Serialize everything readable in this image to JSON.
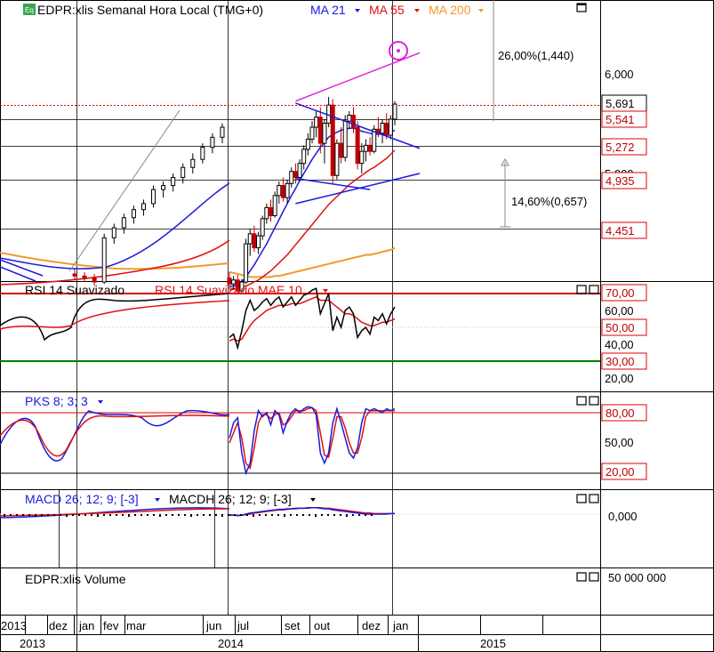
{
  "colors": {
    "grid": "#000000",
    "price_up": "#000000",
    "price_down": "#c00000",
    "ma21": "#1a1adc",
    "ma55": "#e01010",
    "ma200": "#f29a2e",
    "rsi": "#000000",
    "rsi_ma": "#e01010",
    "level_red": "#e00000",
    "level_green": "#008000",
    "trend_blue": "#1a1adc",
    "trend_magenta": "#e020e0"
  },
  "price_panel": {
    "badge": "Eq",
    "title": "EDPR:xlis Semanal Hora Local (TMG+0)",
    "indicators": [
      {
        "label": "MA 21",
        "color": "#1a1adc"
      },
      {
        "label": "MA 55",
        "color": "#e01010"
      },
      {
        "label": "MA 200",
        "color": "#f29a2e"
      }
    ],
    "axis_labels": [
      "6,000",
      "5,000"
    ],
    "price_tags": [
      {
        "text": "5,691",
        "kind": "last"
      },
      {
        "text": "5,541",
        "kind": "red"
      },
      {
        "text": "5,272",
        "kind": "red"
      },
      {
        "text": "4,935",
        "kind": "red"
      },
      {
        "text": "4,451",
        "kind": "red"
      }
    ],
    "annotations": [
      "26,00%(1,440)",
      "14,60%(0,657)"
    ]
  },
  "rsi_panel": {
    "title": "RSI 14 Suavizado",
    "title2": "RSI 14 Suavizado MAE 10",
    "axis_labels": [
      "60,00",
      "40,00",
      "20,00"
    ],
    "level_tags": [
      {
        "text": "70,00",
        "kind": "red"
      },
      {
        "text": "50,00",
        "kind": "red"
      },
      {
        "text": "30,00",
        "kind": "red"
      }
    ]
  },
  "pks_panel": {
    "title": "PKS 8; 3; 3",
    "axis_labels": [
      "50,00"
    ],
    "level_tags": [
      {
        "text": "80,00",
        "kind": "red"
      },
      {
        "text": "20,00",
        "kind": "red"
      }
    ]
  },
  "macd_panel": {
    "title": "MACD 26; 12; 9; [-3]",
    "title2": "MACDH 26; 12; 9; [-3]",
    "axis_labels": [
      "0,000"
    ]
  },
  "volume_panel": {
    "title": "EDPR:xlis Volume",
    "axis_labels": [
      "50 000 000"
    ]
  },
  "time_axis": {
    "months": [
      "2013",
      "dez",
      "jan",
      "fev",
      "mar",
      "jun",
      "jul",
      "set",
      "out",
      "dez",
      "jan"
    ],
    "years": [
      "2013",
      "2014",
      "2015"
    ]
  },
  "chart_data": {
    "type": "candlestick",
    "title": "EDPR:xlis Semanal Hora Local (TMG+0)",
    "period": "weekly",
    "ylim": [
      3.8,
      6.6
    ],
    "candles": [
      {
        "o": 3.96,
        "h": 4.02,
        "l": 3.86,
        "c": 3.9
      },
      {
        "o": 3.9,
        "h": 3.98,
        "l": 3.84,
        "c": 3.94
      },
      {
        "o": 3.94,
        "h": 3.99,
        "l": 3.8,
        "c": 3.83
      },
      {
        "o": 3.83,
        "h": 3.95,
        "l": 3.8,
        "c": 3.92
      },
      {
        "o": 3.92,
        "h": 4.35,
        "l": 3.9,
        "c": 4.3
      },
      {
        "o": 4.3,
        "h": 4.45,
        "l": 4.18,
        "c": 4.4
      },
      {
        "o": 4.4,
        "h": 4.48,
        "l": 4.22,
        "c": 4.26
      },
      {
        "o": 4.26,
        "h": 4.42,
        "l": 4.2,
        "c": 4.38
      },
      {
        "o": 4.38,
        "h": 4.58,
        "l": 4.34,
        "c": 4.55
      },
      {
        "o": 4.55,
        "h": 4.7,
        "l": 4.5,
        "c": 4.66
      },
      {
        "o": 4.66,
        "h": 4.74,
        "l": 4.52,
        "c": 4.58
      },
      {
        "o": 4.58,
        "h": 4.82,
        "l": 4.56,
        "c": 4.78
      },
      {
        "o": 4.78,
        "h": 4.92,
        "l": 4.7,
        "c": 4.88
      },
      {
        "o": 4.88,
        "h": 4.96,
        "l": 4.72,
        "c": 4.76
      },
      {
        "o": 4.76,
        "h": 4.94,
        "l": 4.7,
        "c": 4.9
      },
      {
        "o": 4.9,
        "h": 5.06,
        "l": 4.86,
        "c": 5.02
      },
      {
        "o": 5.02,
        "h": 5.1,
        "l": 4.9,
        "c": 4.96
      },
      {
        "o": 4.96,
        "h": 5.14,
        "l": 4.92,
        "c": 5.1
      },
      {
        "o": 5.1,
        "h": 5.28,
        "l": 5.04,
        "c": 5.24
      },
      {
        "o": 5.24,
        "h": 5.4,
        "l": 5.18,
        "c": 5.34
      },
      {
        "o": 5.34,
        "h": 5.52,
        "l": 5.3,
        "c": 5.46
      },
      {
        "o": 5.46,
        "h": 5.62,
        "l": 5.36,
        "c": 5.56
      },
      {
        "o": 5.56,
        "h": 5.66,
        "l": 5.2,
        "c": 5.3
      },
      {
        "o": 5.3,
        "h": 5.54,
        "l": 5.1,
        "c": 5.5
      },
      {
        "o": 5.5,
        "h": 5.76,
        "l": 5.46,
        "c": 5.68
      },
      {
        "o": 5.68,
        "h": 5.74,
        "l": 4.9,
        "c": 4.98
      },
      {
        "o": 4.98,
        "h": 5.34,
        "l": 4.94,
        "c": 5.3
      },
      {
        "o": 5.3,
        "h": 5.46,
        "l": 5.1,
        "c": 5.16
      },
      {
        "o": 5.16,
        "h": 5.58,
        "l": 5.12,
        "c": 5.52
      },
      {
        "o": 5.52,
        "h": 5.62,
        "l": 5.44,
        "c": 5.58
      },
      {
        "o": 5.58,
        "h": 5.66,
        "l": 5.4,
        "c": 5.46
      },
      {
        "o": 5.46,
        "h": 5.52,
        "l": 5.04,
        "c": 5.1
      },
      {
        "o": 5.1,
        "h": 5.3,
        "l": 5.0,
        "c": 5.22
      },
      {
        "o": 5.22,
        "h": 5.34,
        "l": 5.12,
        "c": 5.28
      },
      {
        "o": 5.28,
        "h": 5.36,
        "l": 5.18,
        "c": 5.22
      },
      {
        "o": 5.22,
        "h": 5.48,
        "l": 5.2,
        "c": 5.44
      },
      {
        "o": 5.44,
        "h": 5.56,
        "l": 5.36,
        "c": 5.4
      },
      {
        "o": 5.4,
        "h": 5.54,
        "l": 5.3,
        "c": 5.5
      },
      {
        "o": 5.5,
        "h": 5.6,
        "l": 5.34,
        "c": 5.38
      },
      {
        "o": 5.38,
        "h": 5.58,
        "l": 5.34,
        "c": 5.54
      },
      {
        "o": 5.54,
        "h": 5.72,
        "l": 5.48,
        "c": 5.69
      }
    ],
    "ma21": [
      3.88,
      3.88,
      3.89,
      3.92,
      3.97,
      4.03,
      4.09,
      4.16,
      4.23,
      4.3,
      4.38,
      4.46,
      4.54,
      4.62,
      4.7,
      4.78,
      4.85,
      4.93,
      5.0,
      5.07,
      5.14,
      5.2,
      5.26,
      5.31,
      5.36,
      5.39,
      5.41,
      5.43,
      5.44,
      5.45,
      5.45,
      5.44,
      5.42,
      5.41,
      5.4,
      5.39,
      5.39,
      5.39,
      5.4,
      5.41,
      5.43
    ],
    "ma55": [
      3.84,
      3.85,
      3.86,
      3.87,
      3.88,
      3.9,
      3.92,
      3.94,
      3.97,
      4.0,
      4.03,
      4.07,
      4.11,
      4.15,
      4.19,
      4.24,
      4.29,
      4.34,
      4.39,
      4.44,
      4.49,
      4.54,
      4.59,
      4.64,
      4.69,
      4.73,
      4.77,
      4.81,
      4.85,
      4.89,
      4.92,
      4.95,
      4.98,
      5.01,
      5.04,
      5.06,
      5.09,
      5.12,
      5.15,
      5.19,
      5.23
    ],
    "ma200": [
      4.02,
      4.01,
      4.0,
      3.99,
      3.98,
      3.97,
      3.97,
      3.97,
      3.97,
      3.97,
      3.97,
      3.98,
      3.98,
      3.99,
      4.0,
      4.01,
      4.02,
      4.03,
      4.04,
      4.05,
      4.06,
      4.07,
      4.08,
      4.09,
      4.1,
      4.11,
      4.12,
      4.13,
      4.14,
      4.15,
      4.16,
      4.17,
      4.18,
      4.19,
      4.19,
      4.2,
      4.21,
      4.22,
      4.23,
      4.24,
      4.26
    ],
    "rsi": [
      44,
      46,
      38,
      48,
      60,
      66,
      60,
      62,
      65,
      67,
      63,
      66,
      68,
      62,
      65,
      68,
      63,
      66,
      69,
      70,
      72,
      73,
      58,
      64,
      70,
      48,
      56,
      50,
      60,
      62,
      58,
      44,
      48,
      50,
      46,
      56,
      54,
      58,
      52,
      58,
      62
    ],
    "rsi_ma": [
      42,
      43,
      42,
      43,
      47,
      51,
      54,
      56,
      58,
      60,
      61,
      62,
      63,
      63,
      63,
      64,
      64,
      64,
      65,
      66,
      67,
      68,
      66,
      66,
      66,
      64,
      62,
      60,
      58,
      58,
      57,
      55,
      53,
      52,
      51,
      51,
      52,
      53,
      53,
      54,
      55
    ],
    "pks_k": [
      55,
      70,
      75,
      40,
      20,
      30,
      62,
      82,
      76,
      80,
      68,
      82,
      78,
      60,
      72,
      80,
      84,
      80,
      84,
      86,
      85,
      78,
      40,
      30,
      40,
      70,
      84,
      70,
      55,
      40,
      35,
      45,
      70,
      84,
      82,
      84,
      82,
      80,
      84,
      82,
      84
    ],
    "pks_d": [
      50,
      60,
      70,
      55,
      30,
      25,
      45,
      70,
      78,
      78,
      74,
      78,
      80,
      68,
      70,
      76,
      82,
      82,
      82,
      84,
      85,
      82,
      60,
      38,
      36,
      55,
      76,
      76,
      65,
      50,
      40,
      40,
      55,
      76,
      82,
      82,
      82,
      82,
      82,
      82,
      82
    ],
    "macd": [
      -0.02,
      -0.02,
      -0.03,
      -0.02,
      0.0,
      0.02,
      0.03,
      0.04,
      0.05,
      0.06,
      0.07,
      0.08,
      0.09,
      0.09,
      0.1,
      0.1,
      0.11,
      0.11,
      0.11,
      0.12,
      0.12,
      0.12,
      0.11,
      0.1,
      0.1,
      0.08,
      0.07,
      0.06,
      0.05,
      0.04,
      0.03,
      0.02,
      0.01,
      0.0,
      0.0,
      0.0,
      0.0,
      0.0,
      0.0,
      0.01,
      0.01
    ],
    "macd_signal": [
      -0.01,
      -0.02,
      -0.02,
      -0.02,
      -0.01,
      0.0,
      0.02,
      0.03,
      0.04,
      0.05,
      0.06,
      0.07,
      0.08,
      0.08,
      0.09,
      0.1,
      0.1,
      0.11,
      0.11,
      0.11,
      0.12,
      0.12,
      0.12,
      0.11,
      0.11,
      0.1,
      0.09,
      0.08,
      0.07,
      0.06,
      0.05,
      0.04,
      0.03,
      0.02,
      0.02,
      0.01,
      0.01,
      0.01,
      0.01,
      0.01,
      0.01
    ],
    "levels": {
      "price": [
        5.541,
        5.272,
        4.935,
        4.451
      ],
      "rsi": [
        70,
        30
      ],
      "pks": [
        80,
        20
      ]
    },
    "trendlines": [
      {
        "color": "blue",
        "from": [
          16,
          4.95
        ],
        "to": [
          28,
          4.84
        ]
      },
      {
        "color": "blue",
        "from": [
          16,
          4.7
        ],
        "to": [
          40,
          5.0
        ]
      },
      {
        "color": "blue",
        "from": [
          16,
          5.7
        ],
        "to": [
          40,
          5.25
        ]
      },
      {
        "color": "magenta",
        "from": [
          16,
          5.72
        ],
        "to": [
          40,
          6.2
        ]
      }
    ]
  }
}
